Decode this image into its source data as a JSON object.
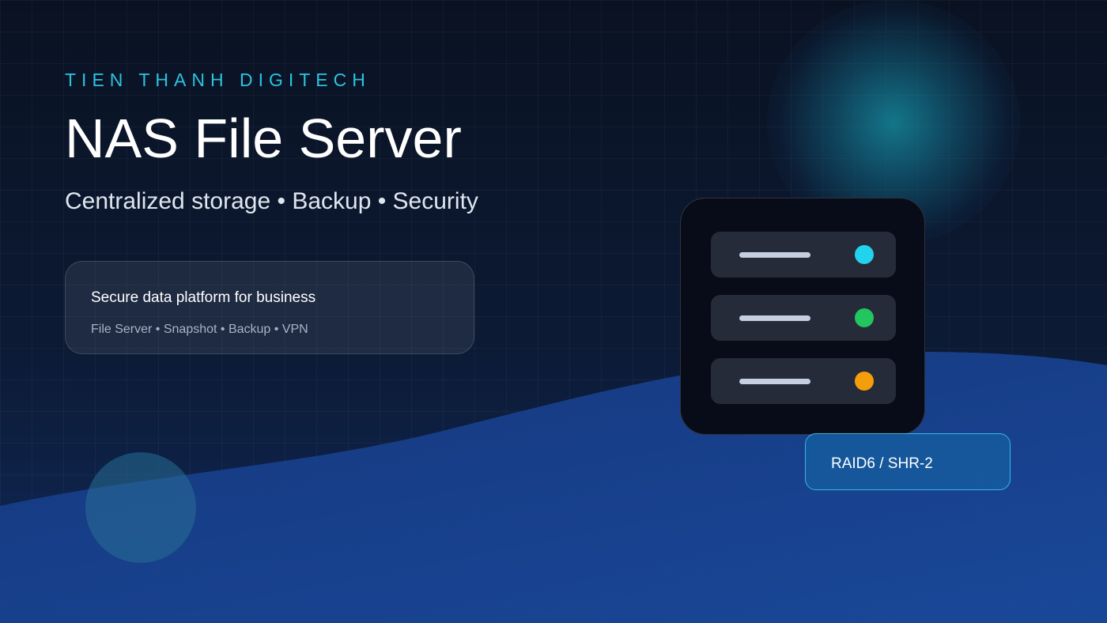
{
  "brand": {
    "company": "TIEN THANH DIGITECH"
  },
  "hero": {
    "title": "NAS File Server",
    "subtitle": "Centralized storage • Backup • Security"
  },
  "info_card": {
    "heading": "Secure data platform for business",
    "features": "File Server • Snapshot • Backup • VPN"
  },
  "server": {
    "bays": [
      {
        "led_color": "#22d3ee"
      },
      {
        "led_color": "#22c55e"
      },
      {
        "led_color": "#f59e0b"
      }
    ]
  },
  "raid_badge": {
    "label": "RAID6 / SHR-2"
  },
  "colors": {
    "accent": "#2cc3e0",
    "background": "#0a1222",
    "wave": "#173d8a"
  }
}
